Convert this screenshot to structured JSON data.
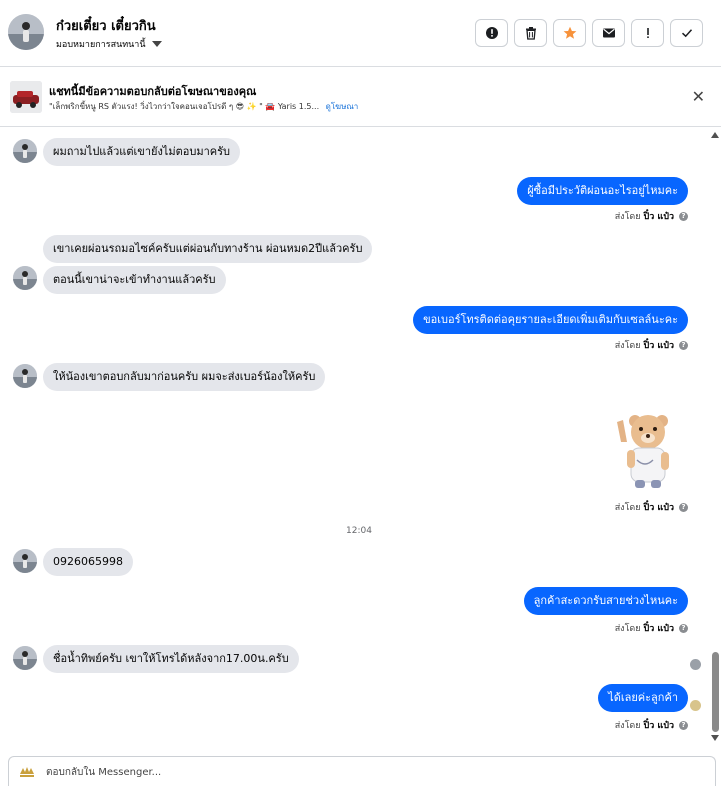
{
  "header": {
    "contact_name": "ก๋วยเตี๋ยว เตี๋ยวกิน",
    "assign_label": "มอบหมายการสนทนานี้",
    "actions": [
      {
        "name": "spam-alert",
        "icon": "alert-circle-icon"
      },
      {
        "name": "delete",
        "icon": "trash-icon"
      },
      {
        "name": "star",
        "icon": "star-icon",
        "color": "#f7923b"
      },
      {
        "name": "mark-unread",
        "icon": "envelope-icon"
      },
      {
        "name": "follow-up",
        "icon": "exclamation-icon"
      },
      {
        "name": "mark-done",
        "icon": "check-icon"
      }
    ]
  },
  "ad_banner": {
    "title": "แชทนี้มีข้อความตอบกลับต่อโฆษณาของคุณ",
    "ad_text": "\"เล็กพริกขี้หนู RS ตัวแรง! วิ่งไวกว่าใจคอนเจอโปรดี ๆ 😎 ✨ \" 🚘 Yaris 1.5...",
    "view_ad_link": "ดูโฆษณา"
  },
  "conversation": {
    "messages_in": [
      "ผมถามไปแล้วแต่เขายังไม่ตอบมาครับ",
      "เขาเคยผ่อนรถมอไซค์ครับแต่ผ่อนกับทางร้าน ผ่อนหมด2ปีแล้วครับ",
      "ตอนนี้เขาน่าจะเข้าทำงานแล้วครับ",
      "ให้น้องเขาตอบกลับมาก่อนครับ ผมจะส่งเบอร์น้องให้ครับ",
      "0926065998",
      "ชื่อน้ำทิพย์ครับ เขาให้โทรได้หลังจาก17.00น.ครับ"
    ],
    "messages_out": [
      "ผู้ซื้อมีประวัติผ่อนอะไรอยู่ไหมคะ",
      "ขอเบอร์โทรติดต่อคุยรายละเอียดเพิ่มเติมกับเซลล์นะคะ",
      "ลูกค้าสะดวกรับสายช่วงไหนคะ",
      "ได้เลยค่ะลูกค้า"
    ],
    "sent_by_prefix": "ส่งโดย",
    "sender_name": "ปิ๋ว แป๋ว",
    "timestamp": "12:04"
  },
  "composer": {
    "placeholder": "ตอบกลับใน Messenger..."
  },
  "colors": {
    "outgoing_bubble": "#0866ff",
    "incoming_bubble": "#e4e6eb",
    "star_accent": "#f7923b"
  }
}
